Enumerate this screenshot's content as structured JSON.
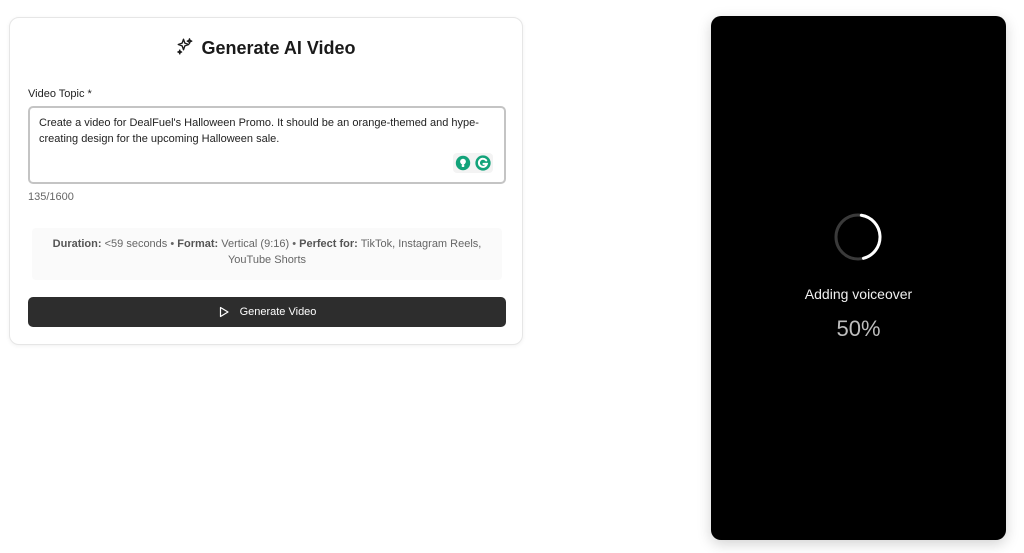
{
  "form": {
    "title": "Generate AI Video",
    "topic_label": "Video Topic *",
    "topic_value": "Create a video for DealFuel's Halloween Promo. It should be an orange-themed and hype-creating design for the upcoming Halloween sale.",
    "char_count": "135/1600",
    "info": {
      "duration_label": "Duration:",
      "duration_value": "<59 seconds",
      "format_label": "Format:",
      "format_value": "Vertical (9:16)",
      "perfect_label": "Perfect for:",
      "perfect_value": "TikTok, Instagram Reels, YouTube Shorts",
      "separator": "•"
    },
    "button_label": "Generate Video",
    "icons": {
      "title_icon": "sparkles-icon",
      "suggestion_icon": "lightbulb-icon",
      "grammar_icon": "grammarly-icon",
      "button_icon": "play-icon"
    }
  },
  "preview": {
    "status": "Adding voiceover",
    "progress_text": "50%",
    "progress_fraction": 0.5
  },
  "colors": {
    "button_bg": "#2d2d2d",
    "preview_bg": "#000000",
    "extension_green": "#12a37a"
  }
}
